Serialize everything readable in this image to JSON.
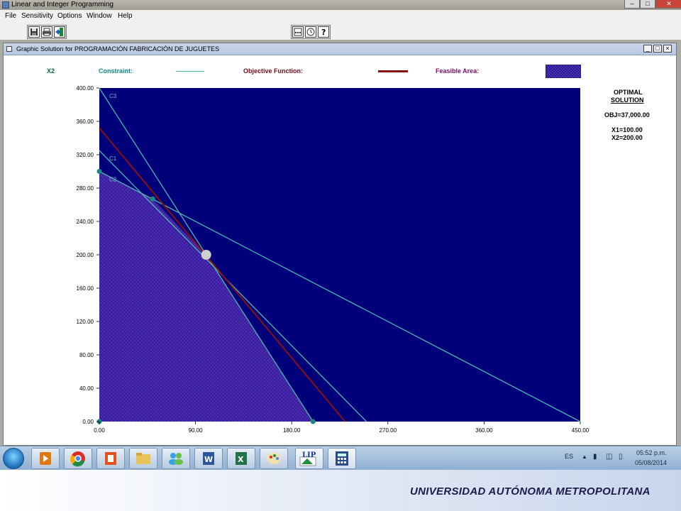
{
  "app": {
    "title": "Linear and Integer Programming",
    "menu": [
      "File",
      "Sensitivity",
      "Options",
      "Window",
      "Help"
    ],
    "window_controls": [
      "–",
      "□",
      "✕"
    ]
  },
  "toolbar": {
    "left_icons": [
      "save-icon",
      "print-icon",
      "exit-icon"
    ],
    "right_icons": [
      "calculator-icon",
      "clock-icon",
      "help-icon"
    ]
  },
  "graph_window": {
    "title": "Graphic Solution for PROGRAMACIÓN FABRICACIÓN DE JUGUETES",
    "controls": [
      "_",
      "□",
      "×"
    ]
  },
  "legend": {
    "y_axis_label": "X2",
    "constraint_label": "Constraint:",
    "objective_label": "Objective Function:",
    "feasible_label": "Feasible Area:",
    "colors": {
      "constraint": "#4cb8ad",
      "objective": "#8a1010",
      "feasible": "#2a1fa0",
      "background": "#00007a",
      "axis_label": "#006a3a",
      "objective_text": "#7a0a1a",
      "feasible_text": "#80106a"
    }
  },
  "solution": {
    "heading_line1": "OPTIMAL",
    "heading_line2": "SOLUTION",
    "obj": "OBJ=37,000.00",
    "x1": "X1=100.00",
    "x2": "X2=200.00"
  },
  "chart_data": {
    "type": "line",
    "xlim": [
      0,
      450
    ],
    "ylim": [
      0,
      400
    ],
    "x_ticks": [
      "0.00",
      "90.00",
      "180.00",
      "270.00",
      "360.00",
      "450.00"
    ],
    "y_ticks": [
      "0.00",
      "40.00",
      "80.00",
      "120.00",
      "160.00",
      "200.00",
      "240.00",
      "280.00",
      "320.00",
      "360.00",
      "400.00"
    ],
    "constraints": [
      {
        "name": "C1",
        "points": [
          [
            0,
            325
          ],
          [
            250,
            0
          ]
        ]
      },
      {
        "name": "C2",
        "points": [
          [
            0,
            300
          ],
          [
            450,
            0
          ]
        ]
      },
      {
        "name": "C3",
        "points": [
          [
            0,
            400
          ],
          [
            200,
            0
          ]
        ]
      }
    ],
    "objective": {
      "points": [
        [
          0,
          352
        ],
        [
          230,
          0
        ]
      ]
    },
    "feasible_region": [
      [
        0,
        0
      ],
      [
        0,
        300
      ],
      [
        50,
        267
      ],
      [
        100,
        200
      ],
      [
        200,
        0
      ]
    ],
    "corner_points": [
      [
        0,
        300
      ],
      [
        50,
        267
      ],
      [
        200,
        0
      ],
      [
        0,
        0
      ]
    ],
    "optimal_point": [
      100,
      200
    ]
  },
  "taskbar": {
    "apps": [
      "media-player-icon",
      "chrome-icon",
      "office-icon",
      "folder-icon",
      "messenger-icon",
      "word-icon",
      "excel-icon",
      "paint-icon",
      "lip-app-icon",
      "calculator-app-icon"
    ],
    "lip_label": "LIP",
    "language": "ES",
    "time": "05:52 p.m.",
    "date": "05/08/2014"
  },
  "footer": {
    "text": "UNIVERSIDAD AUTÓNOMA METROPOLITANA"
  }
}
